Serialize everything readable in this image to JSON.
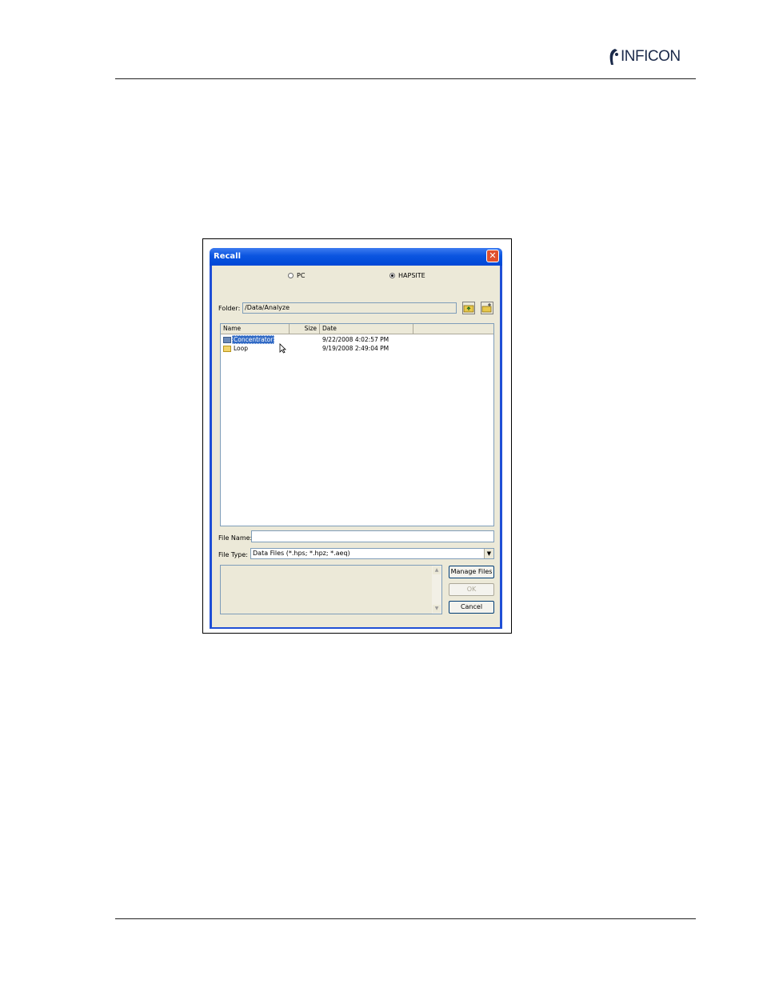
{
  "header": {
    "logo_text": "INFICON"
  },
  "dialog": {
    "title": "Recall",
    "close_glyph": "✕",
    "source_options": [
      {
        "label": "PC",
        "selected": false
      },
      {
        "label": "HAPSITE",
        "selected": true
      }
    ],
    "folder_label": "Folder:",
    "folder_path": "/Data/Analyze",
    "toolbar_icons": [
      "folder-up-icon",
      "new-folder-icon"
    ],
    "columns": [
      "Name",
      "Size",
      "Date"
    ],
    "files": [
      {
        "name": "Concentrator",
        "size": "",
        "date": "9/22/2008 4:02:57 PM",
        "selected": true
      },
      {
        "name": "Loop",
        "size": "",
        "date": "9/19/2008 2:49:04 PM",
        "selected": false
      }
    ],
    "file_name_label": "File Name:",
    "file_name_value": "",
    "file_type_label": "File Type:",
    "file_type_value": "Data Files (*.hps; *.hpz; *.aeq)",
    "buttons": {
      "manage": "Manage Files",
      "ok": "OK",
      "cancel": "Cancel"
    },
    "colors": {
      "titlebar": "#0a55e0",
      "face": "#ece9d8",
      "selection": "#316ac5",
      "close": "#e0502d"
    }
  }
}
